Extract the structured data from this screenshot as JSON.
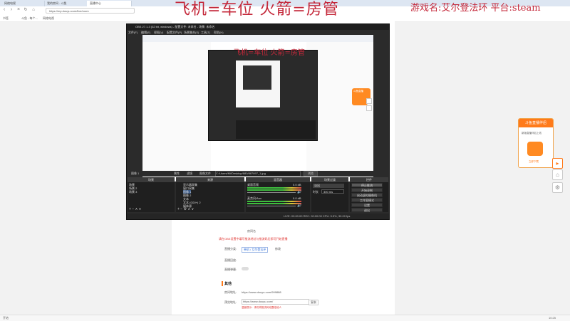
{
  "browser": {
    "tabs": [
      "网络电视",
      "我的房间 - 斗鱼",
      "直播中心"
    ],
    "address": "https://mp.douyu.com/live/room",
    "bookmarks": [
      "书签",
      "斗鱼 - 每个...",
      "网络电视"
    ]
  },
  "overlay": {
    "title": "飞机=车位 火箭=房管",
    "game_line": "游戏名:艾尔登法环 平台:steam"
  },
  "obs": {
    "window_title": "OBS 27.1.3 (32 bit, windows) - 配置文件: 未命名 - 场景: 未命名",
    "menu": [
      "文件(F)",
      "编辑(E)",
      "视图(V)",
      "配置文件(P)",
      "场景集合(S)",
      "工具(T)",
      "帮助(H)"
    ],
    "nested_title": "飞机=车位 火箭=房管",
    "toolbar": {
      "source_label": "图像 1",
      "props": "属性",
      "filters": "滤镜",
      "image_file_label": "图像文件",
      "image_path": "C:/Users/Mi/Desktop/880/887897_1.jpg",
      "browse": "浏览"
    },
    "panels": {
      "scenes_title": "场景",
      "sources_title": "来源",
      "mixer_title": "混音器",
      "transitions_title": "场景过渡",
      "controls_title": "控件"
    },
    "scenes": [
      "场景",
      "场景 2",
      "场景 3"
    ],
    "sources": [
      "显示器采集",
      "窗口采集",
      "图像 1",
      "图像 2",
      "文本",
      "文本 (GDI+) 2",
      "媒体源"
    ],
    "mixer": {
      "channel_1": "桌面音频",
      "channel_1_db": "0.0 dB",
      "channel_2": "麦克风/Aux",
      "channel_2_db": "0.0 dB"
    },
    "transitions": {
      "type": "淡出",
      "duration_label": "时长",
      "duration": "300 ms"
    },
    "controls": [
      "停止推流",
      "开始录制",
      "启动虚拟摄像机",
      "工作室模式",
      "设置",
      "退出"
    ],
    "status": "LIVE: 00:00:00   REC: 00:00:00   CPU: 5.5%, 30.00 fps"
  },
  "page": {
    "notice_line1": "房间名",
    "warning": "请在OBS设置中填写推流地址与推流码后即可开始直播",
    "category_label": "直播分类:",
    "category_value": "单机 / 艾尔登法环",
    "category_modify": "修改",
    "record_label": "直播回放:",
    "fans_label": "直播弹幕:",
    "other_heading": "其他",
    "my_room_label": "房间地址:",
    "my_room_url": "https://www.douyu.com/999888",
    "preview_label": "预览地址:",
    "preview_url": "https://www.douyu.com/",
    "preview_copy": "复制",
    "preview_hint": "温馨提示：请勿将推流码泄露给他人"
  },
  "right_widget": {
    "title": "斗鱼直播伴侣",
    "line": "新版直播伴侣上线",
    "button": "立即下载"
  },
  "orange_widget": {
    "label": "斗鱼直播"
  },
  "taskbar": {
    "left": "开始",
    "right": "10:25"
  },
  "colors": {
    "overlay_red": "#c4283a",
    "obs_bg": "#2b2b2b",
    "accent_orange": "#ff7a1a"
  }
}
